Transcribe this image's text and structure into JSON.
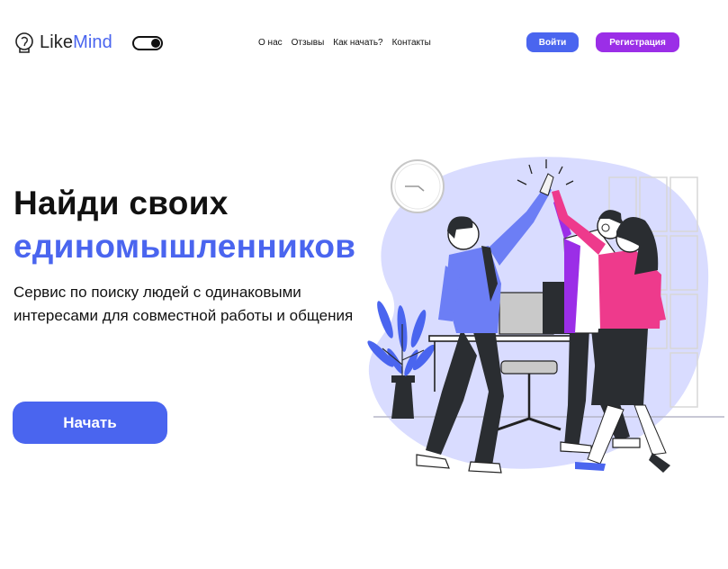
{
  "header": {
    "logo_text_part1": "Like",
    "logo_text_part2": "Mind",
    "nav": [
      "О нас",
      "Отзывы",
      "Как начать?",
      "Контакты"
    ],
    "login_label": "Войти",
    "register_label": "Регистрация"
  },
  "hero": {
    "title_line1": "Найди своих",
    "title_line2": "единомышленников",
    "subtitle": "Сервис по поиску людей с одинаковыми интересами для совместной работы и общения",
    "start_label": "Начать"
  },
  "colors": {
    "accent_blue": "#4a65ef",
    "accent_purple": "#9b2ee7",
    "blob_lavender": "#d9dcff"
  },
  "icons": {
    "logo": "lightbulb-head-icon",
    "toggle": "theme-toggle-icon"
  }
}
